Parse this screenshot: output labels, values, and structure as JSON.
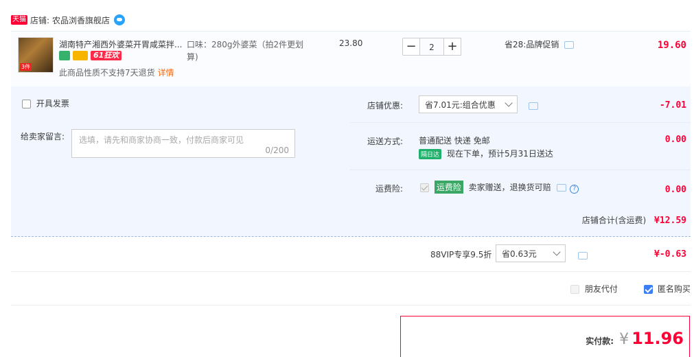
{
  "shop": {
    "badge": "天猫",
    "label": "店铺:",
    "name": "农品浏香旗舰店"
  },
  "item": {
    "title": "湖南特产湘西外婆菜开胃咸菜拌...",
    "thumb_tag": "3件",
    "promo_badge_61": "61狂欢",
    "return_note": "此商品性质不支持7天退货",
    "detail_link": "详情",
    "sku_line1": "口味：280g外婆菜（拍2件更划",
    "sku_line2": "算)",
    "unit_price": "23.80",
    "qty_minus": "−",
    "qty_value": "2",
    "qty_plus": "+",
    "promo_text": "省28:品牌促销",
    "subtotal": "19.60"
  },
  "invoice": {
    "label": "开具发票"
  },
  "message": {
    "label": "给卖家留言:",
    "placeholder": "选填，请先和商家协商一致，付款后商家可见",
    "counter": "0/200"
  },
  "shop_discount": {
    "label": "店铺优惠:",
    "selected": "省7.01元:组合优惠",
    "amount": "-7.01"
  },
  "shipping": {
    "label": "运送方式:",
    "method": "普通配送 快递 免邮",
    "badge": "隔日达",
    "eta": "现在下单，预计5月31日送达",
    "amount": "0.00"
  },
  "insurance": {
    "label": "运费险:",
    "badge": "运费险",
    "desc": "卖家赠送，退换货可赔",
    "help": "?",
    "amount": "0.00"
  },
  "shop_total": {
    "label": "店铺合计(含运费)",
    "amount": "¥12.59"
  },
  "vip": {
    "label": "88VIP专享9.5折",
    "selected": "省0.63元",
    "amount": "¥-0.63"
  },
  "options": {
    "friend_pay": "朋友代付",
    "anonymous": "匿名购买"
  },
  "pay": {
    "label": "实付款:",
    "currency": "¥",
    "amount": "11.96"
  },
  "colors": {
    "accent_red": "#ff0036",
    "panel_bg": "#f2f7ff",
    "green": "#3aa765",
    "blue": "#3c7ef5"
  }
}
